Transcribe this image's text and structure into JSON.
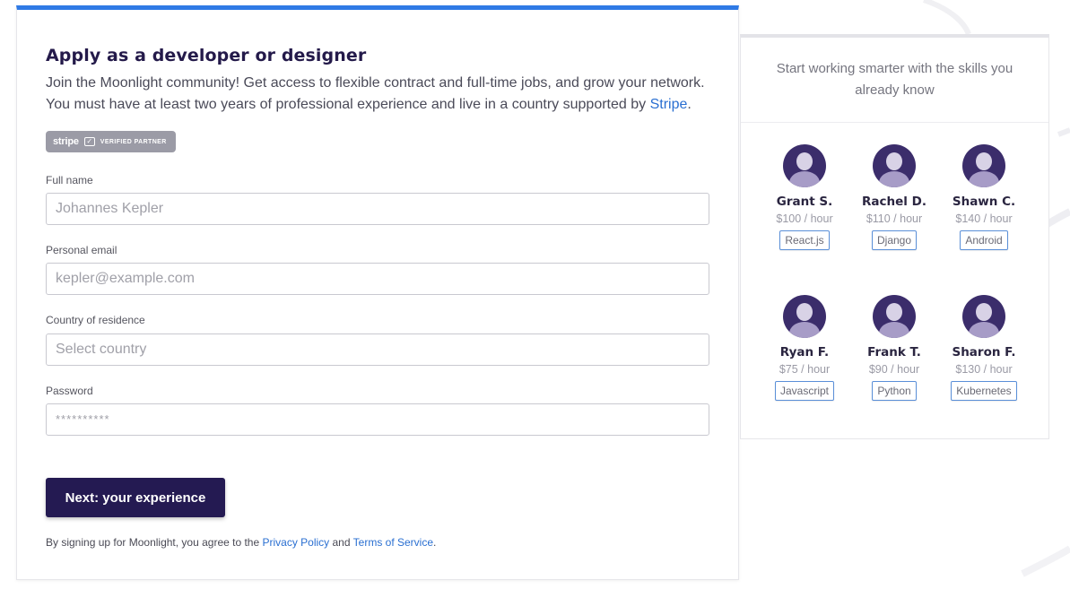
{
  "form": {
    "title": "Apply as a developer or designer",
    "intro_text": "Join the Moonlight community! Get access to flexible contract and full-time jobs, and grow your network. You must have at least two years of professional experience and live in a country supported by ",
    "intro_link": "Stripe",
    "intro_end": ".",
    "badge": {
      "logo": "stripe",
      "icon": "check-icon",
      "text": "VERIFIED PARTNER"
    },
    "fields": {
      "full_name": {
        "label": "Full name",
        "placeholder": "Johannes Kepler",
        "value": ""
      },
      "email": {
        "label": "Personal email",
        "placeholder": "kepler@example.com",
        "value": ""
      },
      "country": {
        "label": "Country of residence",
        "placeholder": "Select country",
        "value": ""
      },
      "password": {
        "label": "Password",
        "placeholder": "**********",
        "value": ""
      }
    },
    "next_button": "Next: your experience",
    "terms": {
      "prefix": "By signing up for Moonlight, you agree to the ",
      "privacy_link": "Privacy Policy",
      "and": " and ",
      "tos_link": "Terms of Service",
      "suffix": "."
    },
    "accent_color": "#2f7ae5",
    "button_color": "#241a52"
  },
  "sidebar": {
    "heading": "Start working smarter with the skills you already know",
    "developers": [
      {
        "name": "Grant S.",
        "rate": "$100 / hour",
        "skill": "React.js"
      },
      {
        "name": "Rachel D.",
        "rate": "$110 / hour",
        "skill": "Django"
      },
      {
        "name": "Shawn C.",
        "rate": "$140 / hour",
        "skill": "Android"
      },
      {
        "name": "Ryan F.",
        "rate": "$75 / hour",
        "skill": "Javascript"
      },
      {
        "name": "Frank T.",
        "rate": "$90 / hour",
        "skill": "Python"
      },
      {
        "name": "Sharon F.",
        "rate": "$130 / hour",
        "skill": "Kubernetes"
      }
    ]
  }
}
